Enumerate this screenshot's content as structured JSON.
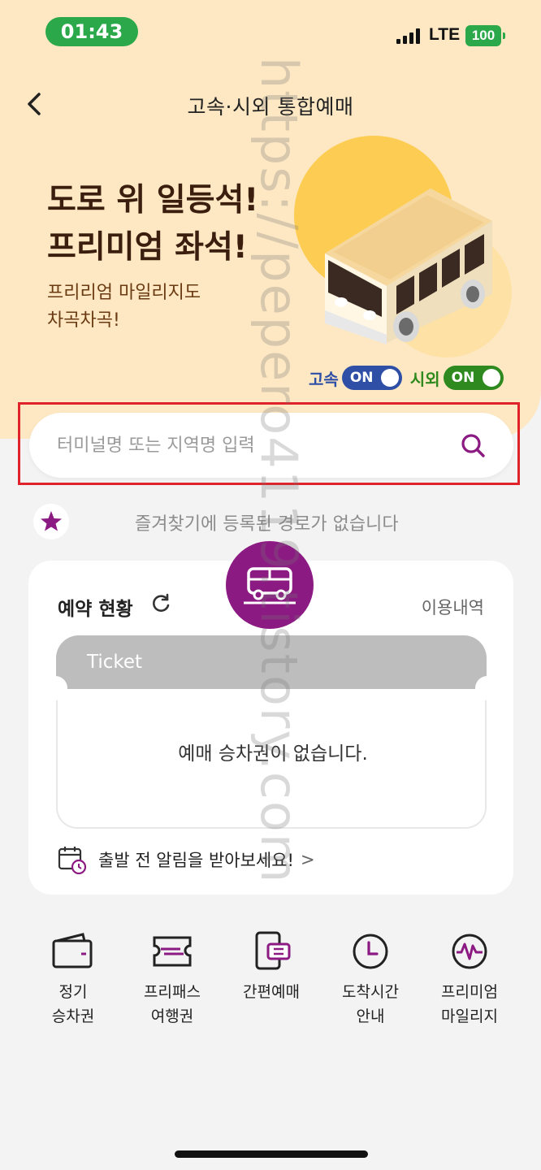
{
  "status_bar": {
    "time": "01:43",
    "network": "LTE",
    "battery": "100"
  },
  "header": {
    "title": "고속·시외 통합예매"
  },
  "hero": {
    "headline_1": "도로 위 일등석!",
    "headline_2": "프리미엄 좌석!",
    "subline_1": "프리리엄 마일리지도",
    "subline_2": "차곡차곡!",
    "toggle_express_label": "고속",
    "toggle_express_state": "ON",
    "toggle_intercity_label": "시외",
    "toggle_intercity_state": "ON"
  },
  "search": {
    "placeholder": "터미널명 또는 지역명 입력"
  },
  "favorites": {
    "empty_text": "즐겨찾기에 등록된 경로가 없습니다"
  },
  "reservation": {
    "title": "예약 현황",
    "history_link": "이용내역",
    "ticket_label": "Ticket",
    "empty_text": "예매 승차권이 없습니다.",
    "alarm_text": "출발 전 알림을 받아보세요!",
    "alarm_chevron": ">"
  },
  "quick_menu": [
    {
      "label": "정기\n승차권",
      "icon": "wallet-icon"
    },
    {
      "label": "프리패스\n여행권",
      "icon": "free-pass-icon"
    },
    {
      "label": "간편예매",
      "icon": "phone-ticket-icon"
    },
    {
      "label": "도착시간\n안내",
      "icon": "clock-icon"
    },
    {
      "label": "프리미엄\n마일리지",
      "icon": "mileage-icon"
    }
  ],
  "watermark": "https://pepero4119.tistory.com",
  "colors": {
    "hero_bg": "#fde8c3",
    "brand_purple": "#8b1a82",
    "express_blue": "#2f4fa6",
    "intercity_green": "#2e8a1e",
    "status_green": "#2ba84a",
    "highlight_red": "#e0232b"
  }
}
